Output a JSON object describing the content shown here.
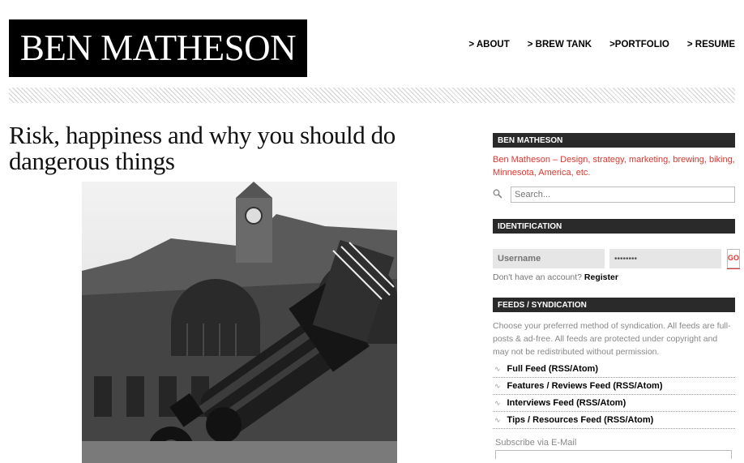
{
  "site": {
    "title": "BEN MATHESON"
  },
  "nav": {
    "items": [
      "> ABOUT",
      "> BREW TANK",
      ">PORTFOLIO",
      "> RESUME"
    ]
  },
  "post": {
    "title": "Risk, happiness and why you should do dangerous things"
  },
  "sidebar": {
    "about_heading": "BEN MATHESON",
    "tagline": "Ben Matheson – Design, strategy, marketing, brewing, biking, Minnesota, America, etc.",
    "search_placeholder": "Search...",
    "identification_heading": "IDENTIFICATION",
    "username_placeholder": "Username",
    "password_value": "••••••••",
    "go_label": "GO",
    "register_prompt": "Don't have an account?",
    "register_link": "Register",
    "feeds_heading": "FEEDS / SYNDICATION",
    "syndication_text": "Choose your preferred method of syndication. All feeds are full-posts & ad-free. All feeds are protected under copyright and may not be redistributed without permission.",
    "feeds": [
      "Full Feed (RSS/Atom)",
      "Features / Reviews Feed (RSS/Atom)",
      "Interviews Feed (RSS/Atom)",
      "Tips / Resources Feed (RSS/Atom)"
    ],
    "subscribe_label": "Subscribe via E-Mail"
  },
  "icons": {
    "search": "search-icon",
    "rss": "rss-icon"
  },
  "colors": {
    "accent": "#e0362f",
    "header_bg": "#2a2a2a",
    "logo_bg": "#000000"
  }
}
